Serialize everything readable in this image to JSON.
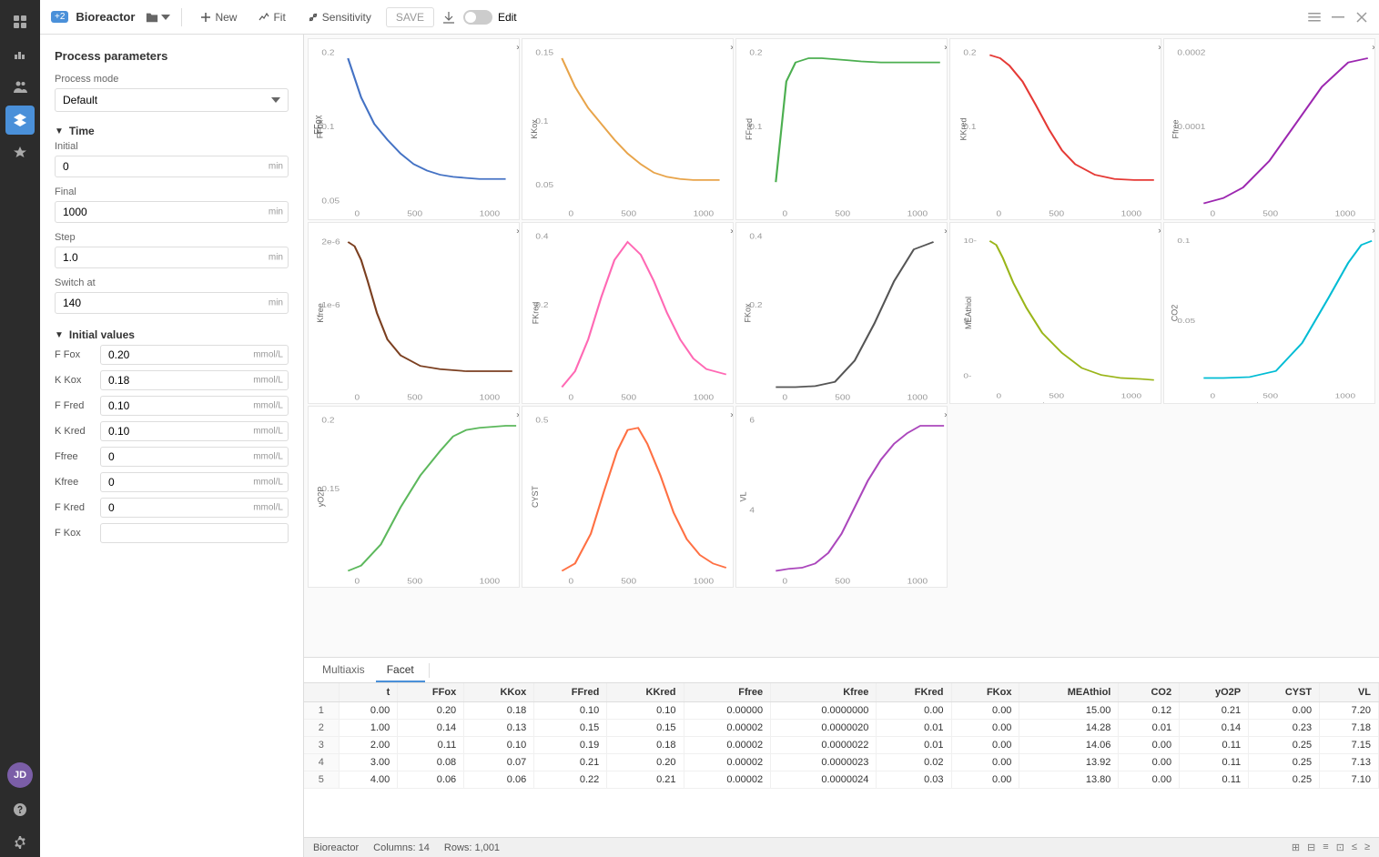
{
  "toolbar": {
    "badge": "+2",
    "title": "Bioreactor",
    "new_label": "New",
    "fit_label": "Fit",
    "sensitivity_label": "Sensitivity",
    "save_label": "SAVE",
    "edit_label": "Edit"
  },
  "sidebar_icons": [
    "grid",
    "chart",
    "people",
    "layers",
    "star",
    "question",
    "gear"
  ],
  "left_panel": {
    "section_title": "Process parameters",
    "process_mode_label": "Process mode",
    "process_mode_value": "Default",
    "time_section": "Time",
    "fields": [
      {
        "label": "Initial",
        "value": "0",
        "unit": "min"
      },
      {
        "label": "Final",
        "value": "1000",
        "unit": "min"
      },
      {
        "label": "Step",
        "value": "1.0",
        "unit": "min"
      },
      {
        "label": "Switch at",
        "value": "140",
        "unit": "min"
      }
    ],
    "initial_values_section": "Initial values",
    "initial_values": [
      {
        "label": "F Fox",
        "value": "0.20",
        "unit": "mmol/L"
      },
      {
        "label": "K Kox",
        "value": "0.18",
        "unit": "mmol/L"
      },
      {
        "label": "F Fred",
        "value": "0.10",
        "unit": "mmol/L"
      },
      {
        "label": "K Kred",
        "value": "0.10",
        "unit": "mmol/L"
      },
      {
        "label": "Ffree",
        "value": "0",
        "unit": "mmol/L"
      },
      {
        "label": "Kfree",
        "value": "0",
        "unit": "mmol/L"
      },
      {
        "label": "F Kred",
        "value": "0",
        "unit": "mmol/L"
      },
      {
        "label": "F Kox",
        "value": "",
        "unit": ""
      }
    ]
  },
  "tabs": [
    "Multiaxis",
    "Facet"
  ],
  "active_tab": "Facet",
  "charts": [
    {
      "id": "FFox",
      "label_y": "FFox",
      "color": "#4472C4",
      "type": "decay"
    },
    {
      "id": "KKox",
      "label_y": "KKox",
      "color": "#E8A44A",
      "type": "decay_slow"
    },
    {
      "id": "FFred",
      "label_y": "FFred",
      "color": "#4CAF50",
      "type": "decay"
    },
    {
      "id": "KKred",
      "label_y": "KKred",
      "color": "#E53935",
      "type": "decay"
    },
    {
      "id": "Ffree",
      "label_y": "Ffree",
      "color": "#9C27B0",
      "type": "growth"
    },
    {
      "id": "Kfree",
      "label_y": "Kfree",
      "color": "#7B3F20",
      "type": "decay_spike"
    },
    {
      "id": "FKred",
      "label_y": "FKred",
      "color": "#FF69B4",
      "type": "bell"
    },
    {
      "id": "FKox",
      "label_y": "FKox",
      "color": "#555555",
      "type": "sigmoid"
    },
    {
      "id": "MEAthiol",
      "label_y": "MEAthiol",
      "color": "#9AB519",
      "type": "decay_slow"
    },
    {
      "id": "CO2",
      "label_y": "CO2",
      "color": "#00BCD4",
      "type": "sigmoid_delay"
    },
    {
      "id": "yO2P",
      "label_y": "yO2P",
      "color": "#5CB85C",
      "type": "growth_slow"
    },
    {
      "id": "CYST",
      "label_y": "CYST",
      "color": "#FF7043",
      "type": "bell"
    },
    {
      "id": "VL",
      "label_y": "VL",
      "color": "#AB47BC",
      "type": "growth_step"
    }
  ],
  "table": {
    "columns": [
      "",
      "t",
      "FFox",
      "KKox",
      "FFred",
      "KKred",
      "Ffree",
      "Kfree",
      "FKred",
      "FKox",
      "MEAthiol",
      "CO2",
      "yO2P",
      "CYST",
      "VL"
    ],
    "rows": [
      [
        1,
        "0.00",
        "0.20",
        "0.18",
        "0.10",
        "0.10",
        "0.00000",
        "0.0000000",
        "0.00",
        "0.00",
        "15.00",
        "0.12",
        "0.21",
        "0.00",
        "7.20"
      ],
      [
        2,
        "1.00",
        "0.14",
        "0.13",
        "0.15",
        "0.15",
        "0.00002",
        "0.0000020",
        "0.01",
        "0.00",
        "14.28",
        "0.01",
        "0.14",
        "0.23",
        "7.18"
      ],
      [
        3,
        "2.00",
        "0.11",
        "0.10",
        "0.19",
        "0.18",
        "0.00002",
        "0.0000022",
        "0.01",
        "0.00",
        "14.06",
        "0.00",
        "0.11",
        "0.25",
        "7.15"
      ],
      [
        4,
        "3.00",
        "0.08",
        "0.07",
        "0.21",
        "0.20",
        "0.00002",
        "0.0000023",
        "0.02",
        "0.00",
        "13.92",
        "0.00",
        "0.11",
        "0.25",
        "7.13"
      ],
      [
        5,
        "4.00",
        "0.06",
        "0.06",
        "0.22",
        "0.21",
        "0.00002",
        "0.0000024",
        "0.03",
        "0.00",
        "13.80",
        "0.00",
        "0.11",
        "0.25",
        "7.10"
      ]
    ]
  },
  "status_bar": {
    "name": "Bioreactor",
    "columns": "Columns: 14",
    "rows": "Rows: 1,001"
  }
}
